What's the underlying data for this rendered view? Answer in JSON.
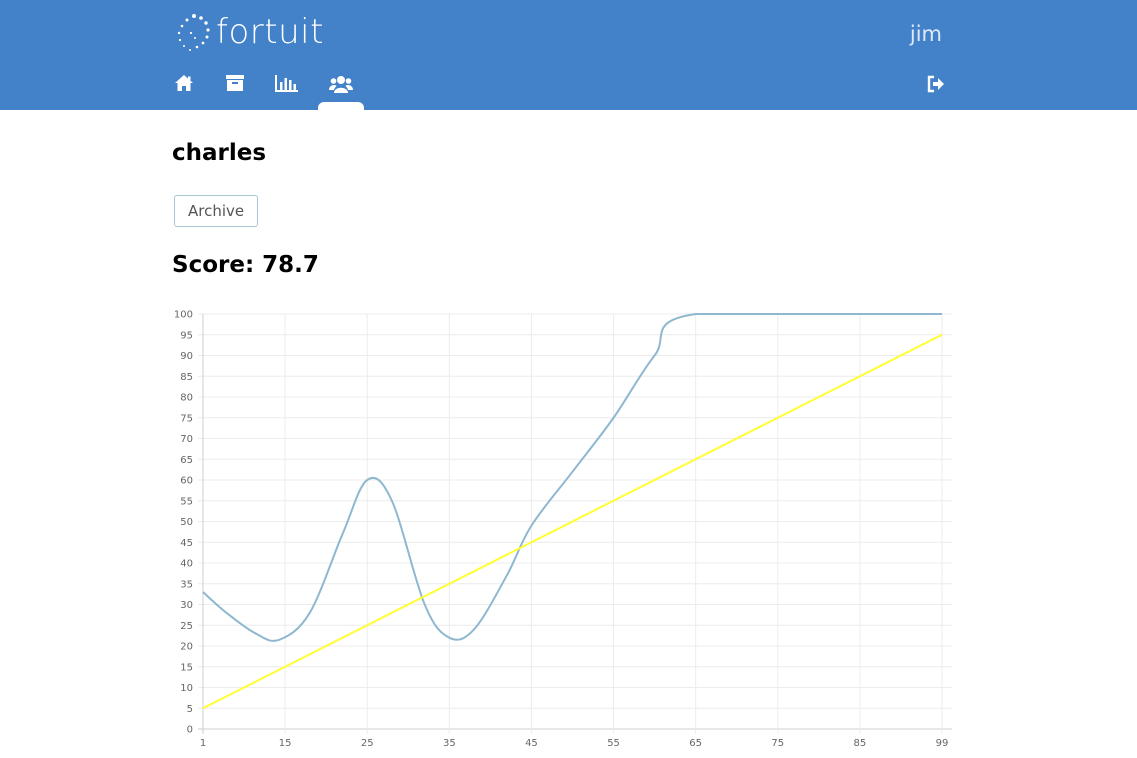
{
  "header": {
    "logo_text": "fortuit",
    "user": "jim",
    "nav": [
      {
        "icon": "home-icon"
      },
      {
        "icon": "archive-icon"
      },
      {
        "icon": "bar-chart-icon"
      },
      {
        "icon": "users-icon",
        "active": true
      }
    ],
    "logout_icon": "logout-icon"
  },
  "colors": {
    "header_bg": "#4382c9",
    "series_actual": "#8fb8d0",
    "series_target": "#ffff33"
  },
  "profile": {
    "name": "charles",
    "archive_label": "Archive",
    "score_text": "Score: 78.7"
  },
  "chart_data": {
    "type": "line",
    "x_ticks": [
      "1",
      "15",
      "25",
      "35",
      "45",
      "55",
      "65",
      "75",
      "85",
      "99"
    ],
    "y_ticks": [
      "0",
      "5",
      "10",
      "15",
      "20",
      "25",
      "30",
      "35",
      "40",
      "45",
      "50",
      "55",
      "60",
      "65",
      "70",
      "75",
      "80",
      "85",
      "90",
      "95",
      "100"
    ],
    "ylim": [
      0,
      100
    ],
    "grid": true,
    "series": [
      {
        "points": [
          [
            1,
            33
          ],
          [
            5,
            28
          ],
          [
            10,
            23
          ],
          [
            14,
            21.5
          ],
          [
            18,
            28
          ],
          [
            22,
            47
          ],
          [
            25,
            60
          ],
          [
            28,
            55
          ],
          [
            32,
            30
          ],
          [
            35,
            22
          ],
          [
            38,
            24
          ],
          [
            42,
            37
          ],
          [
            45,
            49
          ],
          [
            50,
            62
          ],
          [
            55,
            75
          ],
          [
            60,
            90
          ],
          [
            65,
            100
          ],
          [
            99,
            100
          ]
        ]
      },
      {
        "points": [
          [
            1,
            5
          ],
          [
            99,
            95
          ]
        ]
      }
    ]
  }
}
